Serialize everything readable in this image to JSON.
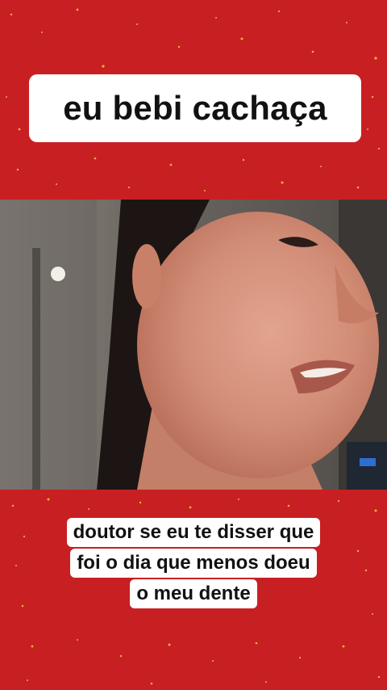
{
  "colors": {
    "background": "#c81f22",
    "sparkle": "#f6c64a",
    "caption_bg": "#ffffff",
    "caption_text": "#111111"
  },
  "top_caption": {
    "text": "eu bebi cachaça"
  },
  "video": {
    "description_icon": "person-video-frame"
  },
  "bottom_caption": {
    "lines": [
      "doutor se eu te disser que",
      "foi o dia que menos doeu",
      "o meu dente"
    ]
  }
}
